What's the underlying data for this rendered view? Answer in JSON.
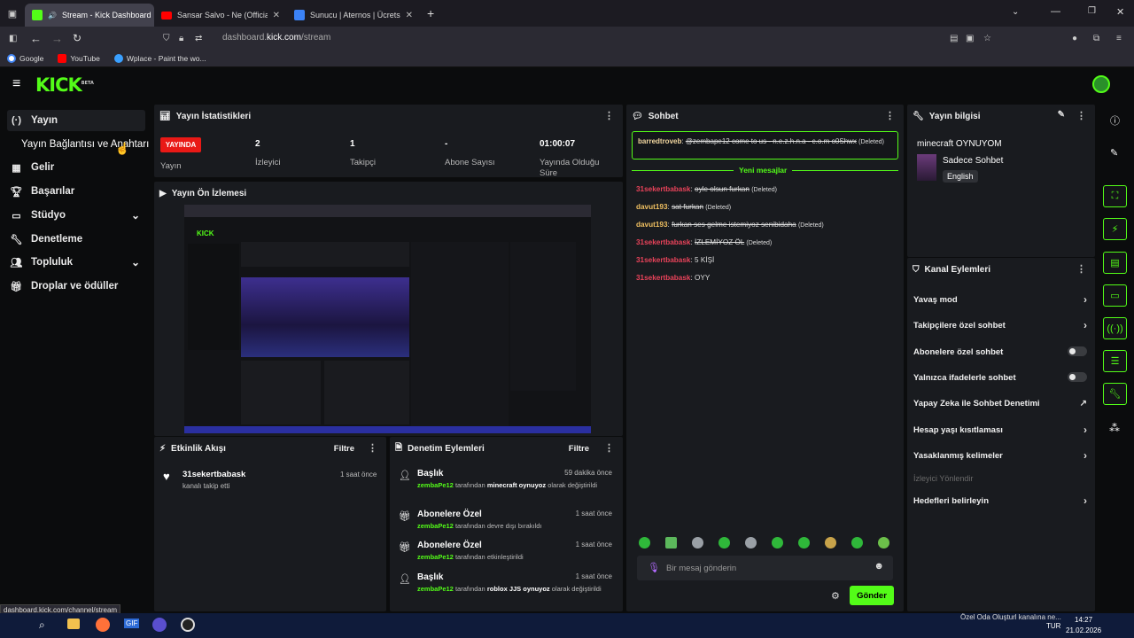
{
  "browser": {
    "tabs": [
      {
        "label": "Stream - Kick Dashboard",
        "active": true,
        "color": "#53fc18"
      },
      {
        "label": "Sansar Salvo - Ne (Official Video)",
        "active": false,
        "color": "#ff0000"
      },
      {
        "label": "Sunucu | Aternos | Ücretsiz Minecraft Sunucu",
        "active": false,
        "color": "#3b82f6"
      }
    ],
    "url_host": "dashboard.",
    "url_domain": "kick.com",
    "url_path": "/stream",
    "bookmarks": [
      "Google",
      "YouTube",
      "Wplace - Paint the wo..."
    ],
    "status_url": "dashboard.kick.com/channel/stream"
  },
  "sidebar": {
    "items": [
      {
        "label": "Yayın",
        "icon": "broadcast-icon"
      },
      {
        "label": "Yayın Bağlantısı ve Anahtarı",
        "icon": ""
      },
      {
        "label": "Gelir",
        "icon": "grid-icon"
      },
      {
        "label": "Başarılar",
        "icon": "trophy-icon"
      },
      {
        "label": "Stüdyo",
        "icon": "studio-icon"
      },
      {
        "label": "Denetleme",
        "icon": "wrench-icon"
      },
      {
        "label": "Topluluk",
        "icon": "people-icon"
      },
      {
        "label": "Droplar ve ödüller",
        "icon": "gift-icon"
      }
    ]
  },
  "stats": {
    "title": "Yayın İstatistikleri",
    "live_badge": "YAYINDA",
    "live_label": "Yayın",
    "viewers": "2",
    "viewers_label": "İzleyici",
    "followers": "1",
    "followers_label": "Takipçi",
    "subs": "-",
    "subs_label": "Abone Sayısı",
    "uptime": "01:00:07",
    "uptime_label": "Yayında Olduğu Süre"
  },
  "preview": {
    "title": "Yayın Ön İzlemesi"
  },
  "activity": {
    "title": "Etkinlik Akışı",
    "filter": "Filtre",
    "items": [
      {
        "user": "31sekertbabask",
        "text": "kanalı takip etti",
        "time": "1 saat önce"
      }
    ]
  },
  "moderation": {
    "title": "Denetim Eylemleri",
    "filter": "Filtre",
    "items": [
      {
        "title": "Başlık",
        "user": "zembaPe12",
        "text": "tarafından",
        "value": "minecraft oynuyoz",
        "suffix": "olarak değiştirildi",
        "time": "59 dakika önce"
      },
      {
        "title": "Abonelere Özel",
        "user": "zembaPe12",
        "text": "tarafından devre dışı bırakıldı",
        "value": "",
        "suffix": "",
        "time": "1 saat önce"
      },
      {
        "title": "Abonelere Özel",
        "user": "zembaPe12",
        "text": "tarafından etkinleştirildi",
        "value": "",
        "suffix": "",
        "time": "1 saat önce"
      },
      {
        "title": "Başlık",
        "user": "zembaPe12",
        "text": "tarafından",
        "value": "roblox JJS oynuyoz",
        "suffix": "olarak değiştirildi",
        "time": "1 saat önce"
      }
    ]
  },
  "chat": {
    "title": "Sohbet",
    "pinned_user": "barredtroveb",
    "pinned_text": "@zembape12 come to us - n.e.z.h.n.a - c.o.m o0Shwx",
    "deleted": "(Deleted)",
    "new_messages": "Yeni mesajlar",
    "messages": [
      {
        "user": "31sekertbabask",
        "text": "oyle olsun furkan",
        "deleted": true,
        "color": "red"
      },
      {
        "user": "davut193",
        "text": "sat furkan",
        "deleted": true,
        "color": "yellow"
      },
      {
        "user": "davut193",
        "text": "furkan ses gelme istemiyoz senibidaha",
        "deleted": true,
        "color": "yellow"
      },
      {
        "user": "31sekertbabask",
        "text": "İZLEMİYOZ ÖL",
        "deleted": true,
        "color": "red"
      },
      {
        "user": "31sekertbabask",
        "text": "5 KİŞİ",
        "deleted": false,
        "color": "red"
      },
      {
        "user": "31sekertbabask",
        "text": "OYY",
        "deleted": false,
        "color": "red"
      }
    ],
    "input_placeholder": "Bir mesaj gönderin",
    "send_label": "Gönder"
  },
  "stream_info": {
    "title": "Yayın bilgisi",
    "stream_title": "minecraft OYNUYOM",
    "category": "Sadece Sohbet",
    "language": "English"
  },
  "channel_actions": {
    "title": "Kanal Eylemleri",
    "items": [
      {
        "label": "Yavaş mod",
        "control": "chevron"
      },
      {
        "label": "Takipçilere özel sohbet",
        "control": "chevron"
      },
      {
        "label": "Abonelere özel sohbet",
        "control": "toggle"
      },
      {
        "label": "Yalnızca ifadelerle sohbet",
        "control": "toggle"
      },
      {
        "label": "Yapay Zeka ile Sohbet Denetimi",
        "control": "external"
      },
      {
        "label": "Hesap yaşı kısıtlaması",
        "control": "chevron"
      },
      {
        "label": "Yasaklanmış kelimeler",
        "control": "chevron"
      },
      {
        "label": "İzleyici Yönlendir",
        "control": "disabled"
      },
      {
        "label": "Hedefleri belirleyin",
        "control": "chevron"
      }
    ]
  },
  "taskbar": {
    "lang": "TUR",
    "time": "14:27",
    "date": "21.02.2026",
    "notification": "Özel Oda Oluşturl kanalına ne..."
  },
  "colors": {
    "accent": "#53fc18",
    "live": "#e91916",
    "bg": "#0b0c0d",
    "panel": "#191b1f"
  }
}
